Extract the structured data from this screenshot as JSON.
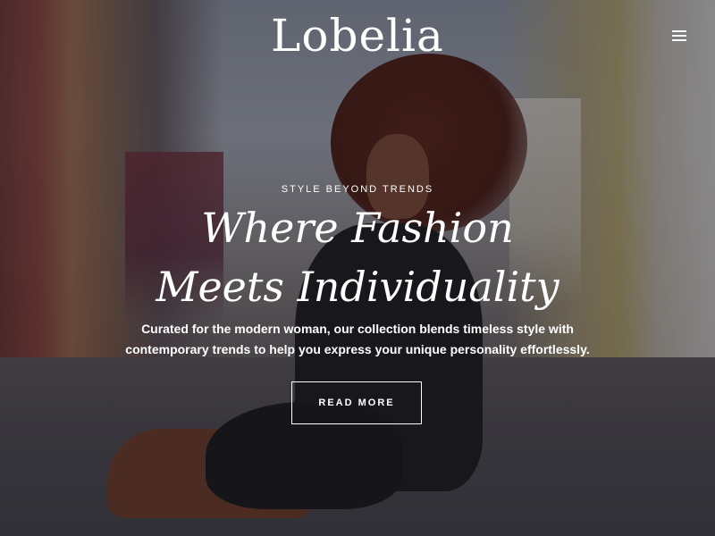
{
  "header": {
    "logo_text": "Lobelia",
    "menu_icon": "hamburger-menu-icon"
  },
  "hero": {
    "eyebrow": "STYLE BEYOND TRENDS",
    "headline": "Where Fashion Meets Individuality",
    "subcopy": "Curated for the modern woman, our collection blends timeless style with contemporary trends to help you express your unique personality effortlessly.",
    "cta_label": "READ MORE"
  },
  "colors": {
    "text": "#ffffff",
    "overlay": "#141218"
  }
}
